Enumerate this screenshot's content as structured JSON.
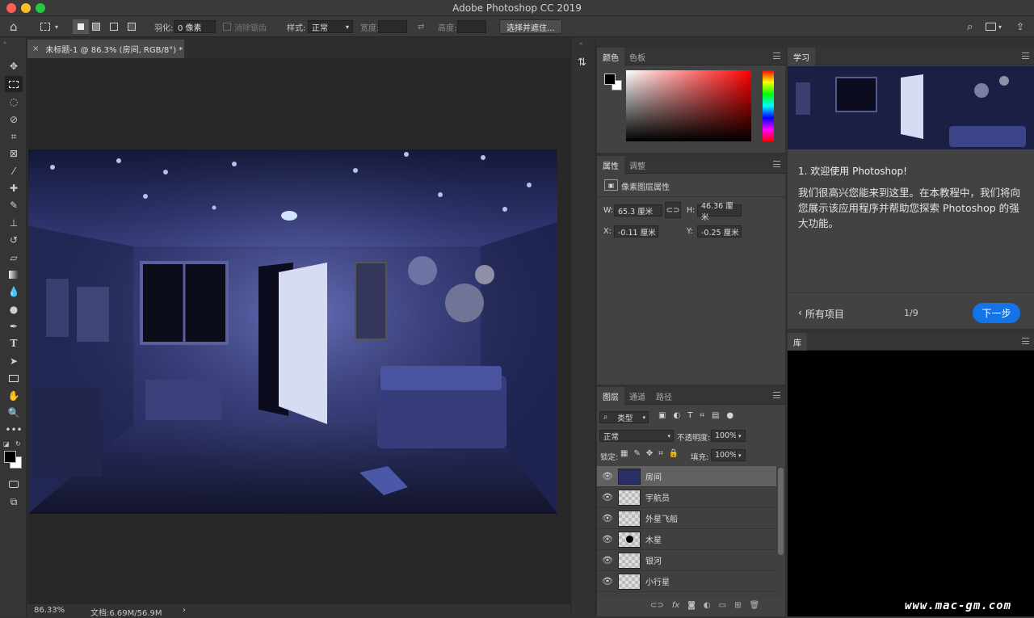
{
  "window": {
    "title": "Adobe Photoshop CC 2019"
  },
  "options_bar": {
    "feather_label": "羽化:",
    "feather_value": "0 像素",
    "anti_alias_label": "消除锯齿",
    "style_label": "样式:",
    "style_value": "正常",
    "width_label": "宽度:",
    "height_label": "高度:",
    "select_mask_button": "选择并遮住..."
  },
  "document": {
    "tab_title": "未标题-1 @ 86.3% (房间, RGB/8°) *",
    "zoom": "86.33%",
    "doc_size": "文档:6.69M/56.9M"
  },
  "color_panel": {
    "tabs": [
      "颜色",
      "色板"
    ]
  },
  "properties_panel": {
    "tabs": [
      "属性",
      "调整"
    ],
    "section_title": "像素图层属性",
    "w_label": "W:",
    "w_value": "65.3 厘米",
    "h_label": "H:",
    "h_value": "46.36 厘米",
    "x_label": "X:",
    "x_value": "-0.11 厘米",
    "y_label": "Y:",
    "y_value": "-0.25 厘米"
  },
  "layers_panel": {
    "tabs": [
      "图层",
      "通道",
      "路径"
    ],
    "filter_kind": "类型",
    "blend_mode": "正常",
    "opacity_label": "不透明度:",
    "opacity_value": "100%",
    "lock_label": "锁定:",
    "fill_label": "填充:",
    "fill_value": "100%",
    "layers": [
      {
        "name": "房间",
        "selected": true
      },
      {
        "name": "宇航员",
        "selected": false
      },
      {
        "name": "外星飞船",
        "selected": false
      },
      {
        "name": "木星",
        "selected": false
      },
      {
        "name": "银河",
        "selected": false
      },
      {
        "name": "小行星",
        "selected": false
      }
    ]
  },
  "learn_panel": {
    "tab": "学习",
    "step_title": "1. 欢迎使用 Photoshop!",
    "body": "我们很高兴您能来到这里。在本教程中，我们将向您展示该应用程序并帮助您探索 Photoshop 的强大功能。",
    "back_link": "所有项目",
    "page": "1/9",
    "next_button": "下一步"
  },
  "library_panel": {
    "tab": "库"
  },
  "watermark": "www.mac-gm.com",
  "colors": {
    "accent": "#1473e6",
    "foreground": "#000000",
    "background": "#ffffff"
  }
}
